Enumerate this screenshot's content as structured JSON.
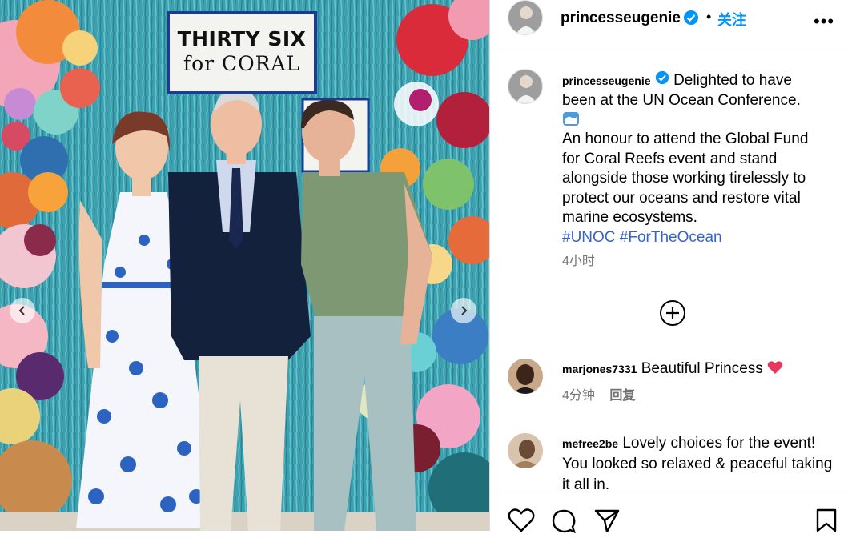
{
  "photo": {
    "sign_line1": "THIRTY SIX",
    "sign_line2": "for CORAL",
    "prev_icon": "chevron-left-icon",
    "next_icon": "chevron-right-icon"
  },
  "header": {
    "username": "princesseugenie",
    "separator": "•",
    "follow_label": "关注",
    "more_label": "•••"
  },
  "caption": {
    "username": "princesseugenie",
    "line1": "Delighted to have been at the UN Ocean Conference.",
    "emoji": "wave-emoji",
    "line2": "An honour to attend the Global Fund for Coral Reefs event and stand alongside those working tirelessly to protect our oceans and restore vital marine ecosystems.",
    "hashtag1": "#UNOC",
    "hashtag2": "#ForTheOcean",
    "time": "4小时"
  },
  "comments": [
    {
      "username": "marjones7331",
      "text": "Beautiful Princess",
      "emoji": "heart-emoji",
      "time": "4分钟",
      "reply_label": "回复"
    },
    {
      "username": "mefree2be",
      "text": "Lovely choices for the event! You looked so relaxed & peaceful taking it all in."
    }
  ],
  "colors": {
    "follow_blue": "#0095f6",
    "verified_blue": "#0095f6",
    "hashtag": "#3763c8",
    "heart": "#e8365d"
  }
}
